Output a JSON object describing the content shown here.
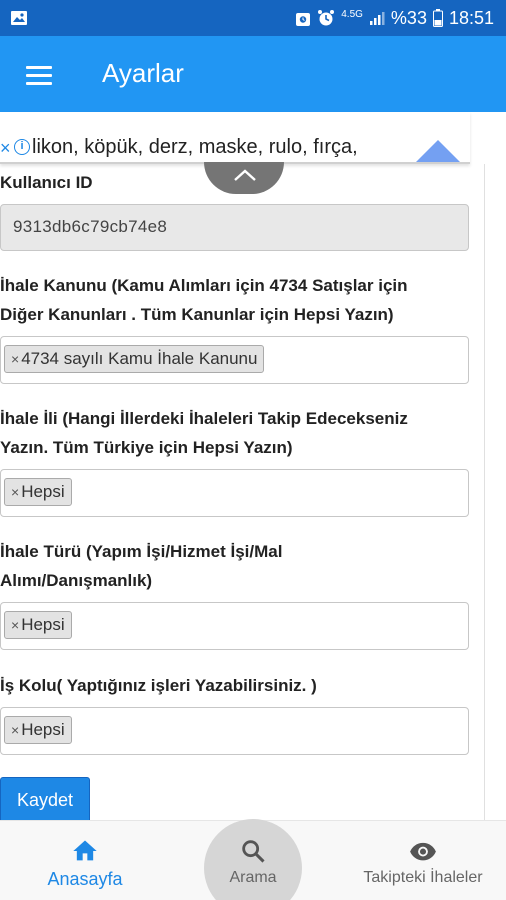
{
  "status_bar": {
    "battery_percent": "%33",
    "time": "18:51",
    "network": "4.5G"
  },
  "app_bar": {
    "title": "Ayarlar",
    "menu_icon": "hamburger-menu-icon"
  },
  "ad_banner": {
    "text": "likon, köpük, derz, maske, rulo, fırça,"
  },
  "form": {
    "user_id": {
      "label": "Kullanıcı ID",
      "value": "9313db6c79cb74e8"
    },
    "law": {
      "label_line1": "İhale Kanunu (Kamu Alımları için 4734 Satışlar için",
      "label_line2": "Diğer Kanunları . Tüm Kanunlar için Hepsi Yazın)",
      "tag": "4734 sayılı Kamu İhale Kanunu"
    },
    "province": {
      "label_line1": "İhale İli (Hangi İllerdeki İhaleleri Takip Edecekseniz",
      "label_line2": "Yazın. Tüm Türkiye için Hepsi Yazın)",
      "tag": "Hepsi"
    },
    "type": {
      "label_line1": "İhale Türü (Yapım İşi/Hizmet İşi/Mal",
      "label_line2": "Alımı/Danışmanlık)",
      "tag": "Hepsi"
    },
    "business": {
      "label": "İş Kolu( Yaptığınız işleri Yazabilirsiniz. )",
      "tag": "Hepsi"
    },
    "tag_remove_symbol": "×",
    "save_label": "Kaydet"
  },
  "bottom_nav": {
    "home": "Anasayfa",
    "search": "Arama",
    "following": "Takipteki İhaleler"
  },
  "colors": {
    "status_bar": "#1565c0",
    "app_bar": "#2196f3",
    "accent": "#1e88e5"
  }
}
